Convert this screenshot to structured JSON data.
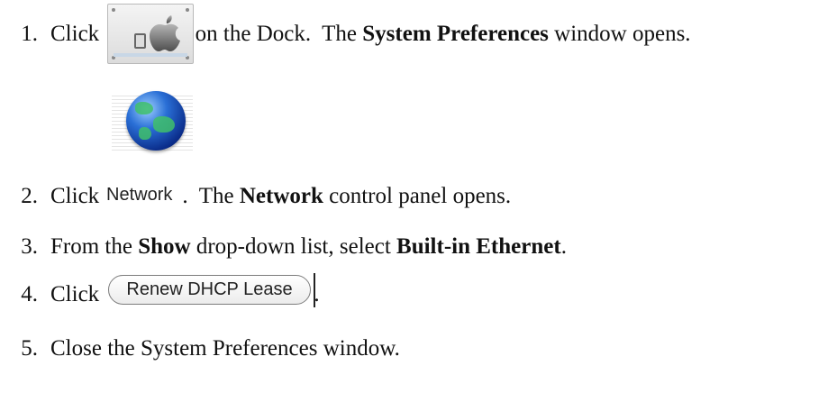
{
  "steps": [
    {
      "number": "1.",
      "before": "Click ",
      "after": " on the Dock.  The ",
      "bold1": "System Preferences",
      "tail": " window opens."
    },
    {
      "number": "2.",
      "before": "Click ",
      "after": ".  The ",
      "bold1": "Network",
      "tail": " control panel opens."
    },
    {
      "number": "3.",
      "before": "From the ",
      "bold1": "Show",
      "middle": " drop-down list, select ",
      "bold2": "Built-in Ethernet",
      "tail": "."
    },
    {
      "number": "4.",
      "before": "Click ",
      "tail": "."
    },
    {
      "number": "5.",
      "before": "Close the System Preferences window."
    }
  ],
  "icons": {
    "step1": "system-preferences-icon",
    "step2": "network-globe-icon"
  },
  "network_icon_label": "Network",
  "renew_button_label": "Renew DHCP Lease"
}
